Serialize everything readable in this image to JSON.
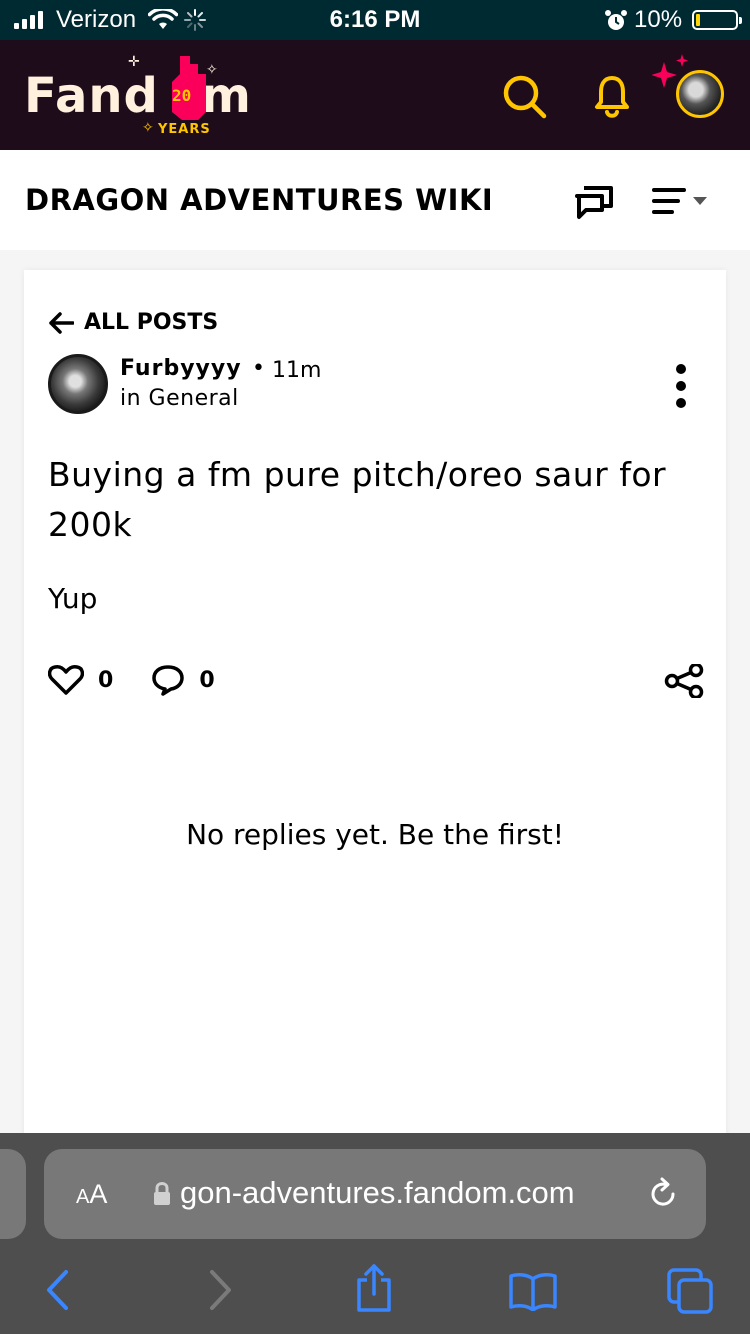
{
  "status_bar": {
    "carrier": "Verizon",
    "time": "6:16 PM",
    "battery": "10%",
    "battery_level": 0.1
  },
  "fandom_header": {
    "logo_left": "Fand",
    "logo_right": "m",
    "logo_badge": "20",
    "logo_years": "YEARS",
    "colors": {
      "bg": "#1e0c1b",
      "accent": "#ffc500",
      "flame": "#fa005a"
    }
  },
  "wiki": {
    "title": "DRAGON ADVENTURES WIKI"
  },
  "post": {
    "back_label": "ALL POSTS",
    "author": "Furbyyyy",
    "separator": "•",
    "time_ago": "11m",
    "category": "in General",
    "title": "Buying a fm pure pitch/oreo saur for 200k",
    "body": "Yup",
    "likes": "0",
    "replies": "0",
    "no_replies_text": "No replies yet. Be the first!"
  },
  "browser": {
    "text_size_label_small": "A",
    "text_size_label_large": "A",
    "url": "gon-adventures.fandom.com",
    "toolbar": [
      "back",
      "forward",
      "share",
      "bookmarks",
      "tabs"
    ],
    "accent": "#3a86ff"
  }
}
